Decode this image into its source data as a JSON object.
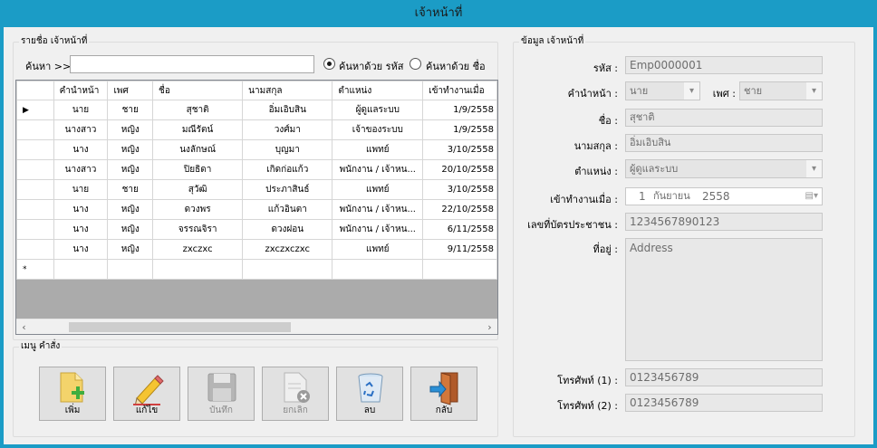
{
  "window": {
    "title": "เจ้าหน้าที่"
  },
  "list_group": {
    "legend": "รายชื่อ เจ้าหน้าที่",
    "search_label": "ค้นหา >>",
    "search_value": "",
    "radio_by_code": "ค้นหาด้วย รหัส",
    "radio_by_name": "ค้นหาด้วย ชื่อ",
    "selected_radio": "code"
  },
  "grid": {
    "columns": [
      "คำนำหน้า",
      "เพศ",
      "ชื่อ",
      "นามสกุล",
      "ตำแหน่ง",
      "เข้าทำงานเมื่อ"
    ],
    "current_row_marker": "▶",
    "new_row_marker": "*",
    "rows": [
      [
        "นาย",
        "ชาย",
        "สุชาติ",
        "อิ่มเอิบสิน",
        "ผู้ดูแลระบบ",
        "1/9/2558"
      ],
      [
        "นางสาว",
        "หญิง",
        "มณีรัตน์",
        "วงศ์มา",
        "เจ้าของระบบ",
        "1/9/2558"
      ],
      [
        "นาง",
        "หญิง",
        "นงลักษณ์",
        "บุญมา",
        "แพทย์",
        "3/10/2558"
      ],
      [
        "นางสาว",
        "หญิง",
        "ปิยธิดา",
        "เกิดก่อแก้ว",
        "พนักงาน / เจ้าหน...",
        "20/10/2558"
      ],
      [
        "นาย",
        "ชาย",
        "สุวัฒิ",
        "ประภาสินธ์",
        "แพทย์",
        "3/10/2558"
      ],
      [
        "นาง",
        "หญิง",
        "ดวงพร",
        "แก้วอินตา",
        "พนักงาน / เจ้าหน...",
        "22/10/2558"
      ],
      [
        "นาง",
        "หญิง",
        "จรรณจิรา",
        "ดวงฝอน",
        "พนักงาน / เจ้าหน...",
        "6/11/2558"
      ],
      [
        "นาง",
        "หญิง",
        "zxczxc",
        "zxczxczxc",
        "แพทย์",
        "9/11/2558"
      ]
    ]
  },
  "menu_group": {
    "legend": "เมนู คำสั่ง",
    "buttons": [
      {
        "label": "เพิ่ม",
        "icon": "add-file-icon",
        "enabled": true
      },
      {
        "label": "แก้ไข",
        "icon": "pencil-icon",
        "enabled": true
      },
      {
        "label": "บันทึก",
        "icon": "save-disk-icon",
        "enabled": false
      },
      {
        "label": "ยกเลิก",
        "icon": "cancel-document-icon",
        "enabled": false
      },
      {
        "label": "ลบ",
        "icon": "recycle-bin-icon",
        "enabled": true
      },
      {
        "label": "กลับ",
        "icon": "exit-door-icon",
        "enabled": true
      }
    ]
  },
  "detail_group": {
    "legend": "ข้อมูล เจ้าหน้าที่",
    "code_label": "รหัส :",
    "code_value": "Emp0000001",
    "prefix_label": "คำนำหน้า :",
    "prefix_value": "นาย",
    "gender_label": "เพศ :",
    "gender_value": "ชาย",
    "firstname_label": "ชื่อ :",
    "firstname_value": "สุชาติ",
    "lastname_label": "นามสกุล :",
    "lastname_value": "อิ่มเอิบสิน",
    "position_label": "ตำแหน่ง :",
    "position_value": "ผู้ดูแลระบบ",
    "startdate_label": "เข้าทำงานเมื่อ :",
    "startdate_day": "1",
    "startdate_month": "กันยายน",
    "startdate_year": "2558",
    "idcard_label": "เลขที่บัตรประชาชน :",
    "idcard_value": "1234567890123",
    "address_label": "ที่อยู่ :",
    "address_value": "Address",
    "phone1_label": "โทรศัพท์ (1) :",
    "phone1_value": "0123456789",
    "phone2_label": "โทรศัพท์ (2) :",
    "phone2_value": "0123456789"
  }
}
